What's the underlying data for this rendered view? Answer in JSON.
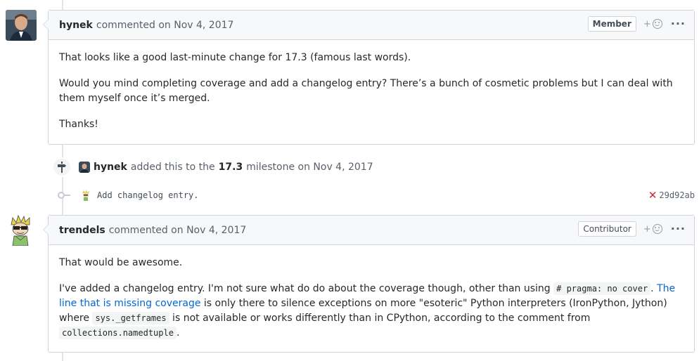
{
  "comments": [
    {
      "author": "hynek",
      "meta": "commented on Nov 4, 2017",
      "role": "Member",
      "reaction_plus": "+",
      "more": "···",
      "paragraphs": [
        "That looks like a good last-minute change for 17.3 (famous last words).",
        "Would you mind completing coverage and add a changelog entry? There’s a bunch of cosmetic problems but I can deal with them myself once it’s merged.",
        "Thanks!"
      ]
    },
    {
      "author": "trendels",
      "meta": "commented on Nov 4, 2017",
      "role": "Contributor",
      "reaction_plus": "+",
      "more": "···",
      "p1": "That would be awesome.",
      "p2_a": "I've added a changelog entry. I'm not sure what do do about the coverage though, other than using ",
      "p2_code1": "# pragma: no cover",
      "p2_b": ". ",
      "p2_link": "The line that is missing coverage",
      "p2_c": " is only there to silence exceptions on more \"esoteric\" Python interpreters (IronPython, Jython) where ",
      "p2_code2": "sys._getframes",
      "p2_d": " is not available or works differently than in CPython, according to the comment from ",
      "p2_code3": "collections.namedtuple",
      "p2_e": "."
    }
  ],
  "milestone_event": {
    "actor": "hynek",
    "text_a": "added this to the",
    "milestone": "17.3",
    "text_b": "milestone on Nov 4, 2017"
  },
  "commit": {
    "message": "Add changelog entry.",
    "status": "failure",
    "sha": "29d92ab"
  },
  "icons": {
    "milestone": "milestone-icon",
    "commit": "git-commit-icon",
    "status": "x-icon",
    "reaction": "smiley-icon",
    "more": "kebab-horizontal-icon"
  },
  "colors": {
    "link": "#0366d6",
    "failure": "#cb2431",
    "header_bg": "#f6f8fa",
    "border": "#d1d5da"
  }
}
